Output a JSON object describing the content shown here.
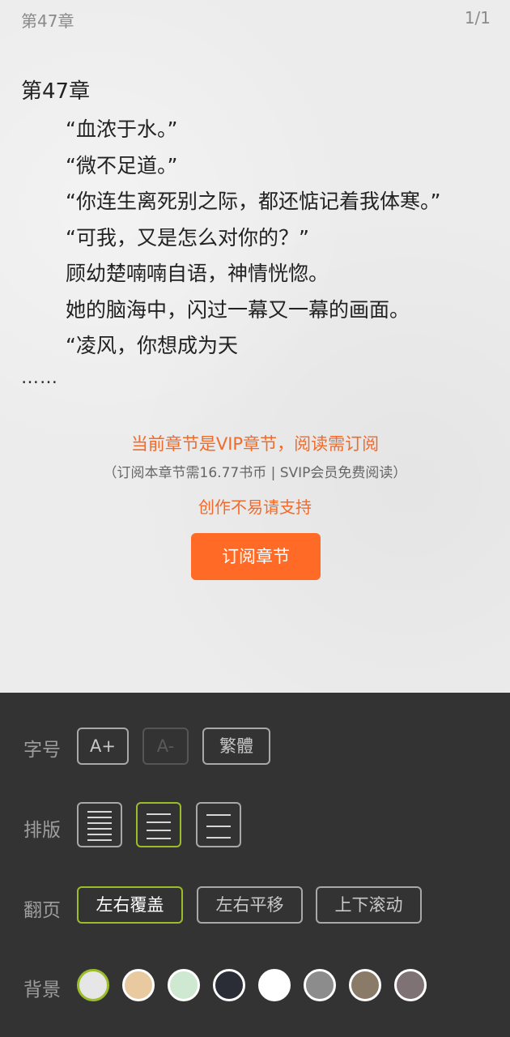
{
  "topbar": {
    "chapter": "第47章",
    "page": "1/1"
  },
  "chapter": {
    "title": "第47章",
    "paragraphs": [
      "“血浓于水。”",
      "“微不足道。”",
      "“你连生离死别之际，都还惦记着我体寒。”",
      "“可我，又是怎么对你的？”",
      "顾幼楚喃喃自语，神情恍惚。",
      "她的脑海中，闪过一幕又一幕的画面。",
      "“凌风，你想成为天"
    ],
    "ellipsis": "……"
  },
  "vip": {
    "title": "当前章节是VIP章节，阅读需订阅",
    "note": "（订阅本章节需16.77书币 | SVIP会员免费阅读）",
    "support": "创作不易请支持",
    "button": "订阅章节"
  },
  "settings": {
    "font_size": {
      "label": "字号",
      "increase": "A+",
      "decrease": "A-",
      "traditional": "繁體"
    },
    "layout": {
      "label": "排版",
      "selected_index": 1
    },
    "page_turn": {
      "label": "翻页",
      "options": [
        "左右覆盖",
        "左右平移",
        "上下滚动"
      ],
      "selected": "左右覆盖"
    },
    "background": {
      "label": "背景",
      "colors": [
        "#e6e6e6",
        "#e8c9a0",
        "#cfe8d2",
        "#2b2d36",
        "#ffffff",
        "#8c8c8c",
        "#8a7b68",
        "#7e7274"
      ],
      "selected_index": 0
    }
  }
}
